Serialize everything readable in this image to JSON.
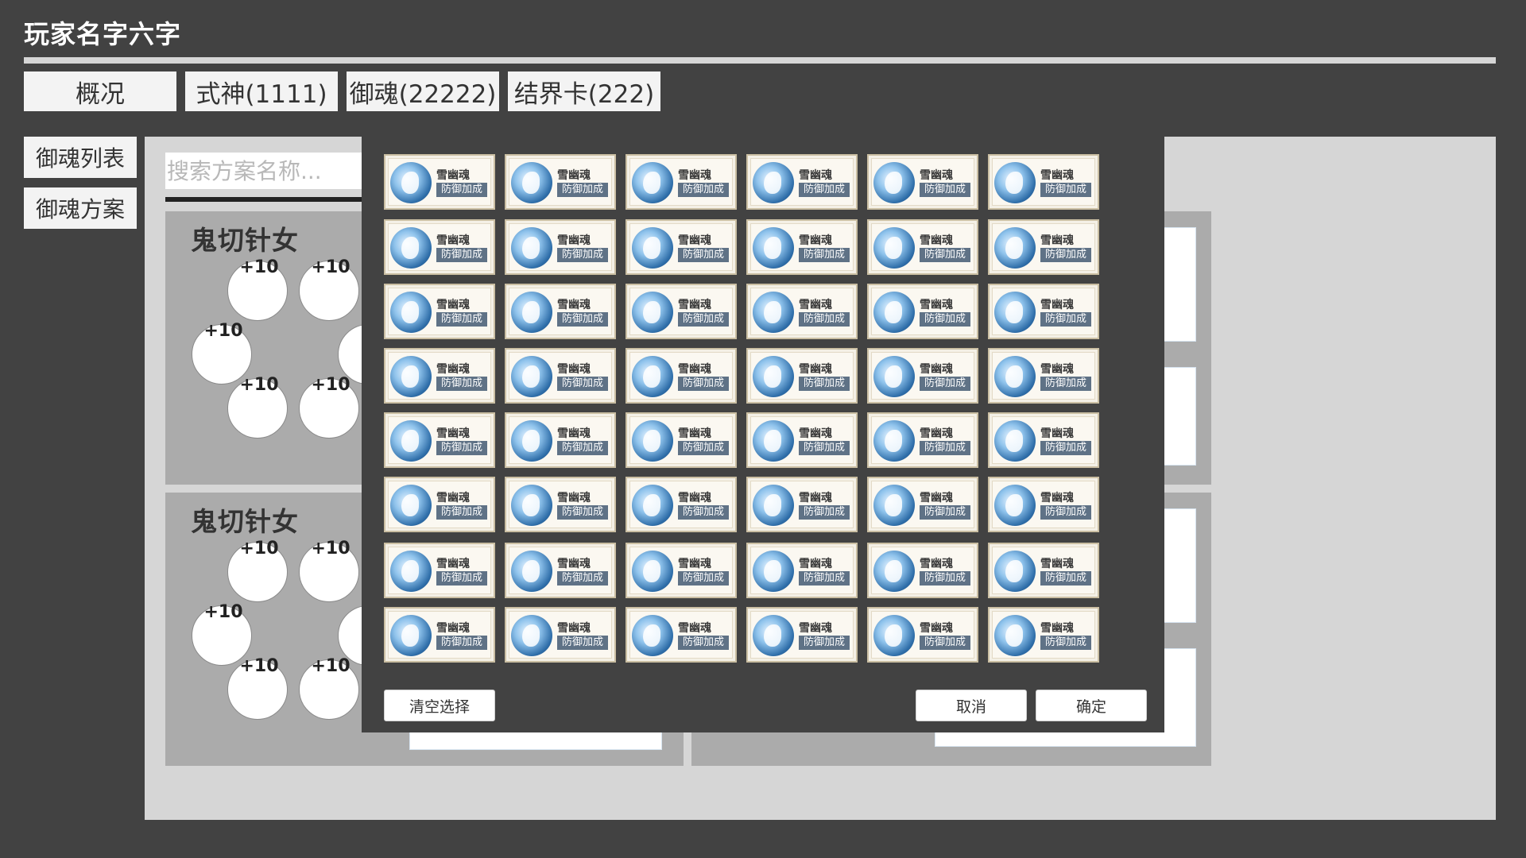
{
  "player_name": "玩家名字六字",
  "tabs": [
    {
      "label": "概况"
    },
    {
      "label": "式神(1111)"
    },
    {
      "label": "御魂(22222)"
    },
    {
      "label": "结界卡(222)"
    }
  ],
  "subnav": [
    {
      "label": "御魂列表"
    },
    {
      "label": "御魂方案"
    }
  ],
  "search": {
    "placeholder": "搜索方案名称..."
  },
  "plans": [
    {
      "name": "鬼切针女",
      "slot_levels": [
        "+10",
        "+10",
        "+10",
        "+10",
        "+10",
        "+10"
      ]
    },
    {
      "name": "鬼切针女",
      "slot_levels": [
        "+10",
        "+10",
        "+10",
        "+10",
        "+10",
        "+10"
      ]
    }
  ],
  "modal": {
    "soul_item": {
      "name": "雪幽魂",
      "tag": "防御加成"
    },
    "buttons": {
      "clear": "清空选择",
      "cancel": "取消",
      "confirm": "确定"
    }
  }
}
